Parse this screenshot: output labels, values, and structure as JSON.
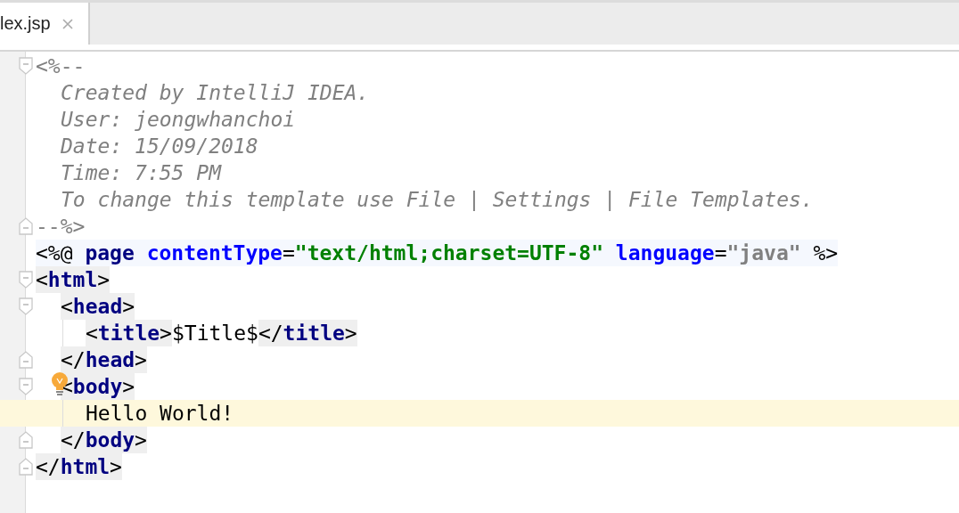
{
  "tabs": [
    {
      "label": "lex.jsp",
      "selected": true
    }
  ],
  "lines": [
    {
      "kind": "fold-start",
      "tokens": [
        {
          "kind": "comment-mark",
          "text": "<%--"
        }
      ],
      "children": [
        {
          "kind": "plain",
          "tokens": [
            {
              "kind": "comment",
              "text": "Created by IntelliJ IDEA."
            }
          ]
        },
        {
          "kind": "plain",
          "tokens": [
            {
              "kind": "comment",
              "text": "User: jeongwhanchoi"
            }
          ]
        },
        {
          "kind": "plain",
          "tokens": [
            {
              "kind": "comment",
              "text": "Date: 15/09/2018"
            }
          ]
        },
        {
          "kind": "plain",
          "tokens": [
            {
              "kind": "comment",
              "text": "Time: 7:55 PM"
            }
          ]
        },
        {
          "kind": "plain",
          "tokens": [
            {
              "kind": "comment",
              "text": "To change this template use File | Settings | File Templates."
            }
          ]
        }
      ]
    },
    {
      "kind": "fold-end",
      "tokens": [
        {
          "kind": "comment-mark",
          "text": "--%>"
        }
      ]
    },
    {
      "kind": "directive",
      "tokens": [
        {
          "kind": "punct",
          "text": "<%@ "
        },
        {
          "kind": "keyword",
          "text": "page "
        },
        {
          "kind": "attr",
          "text": "contentType"
        },
        {
          "kind": "punct",
          "text": "="
        },
        {
          "kind": "string",
          "text": "\"text/html;charset=UTF-8\" "
        },
        {
          "kind": "attr",
          "text": "language"
        },
        {
          "kind": "punct",
          "text": "="
        },
        {
          "kind": "value",
          "text": "\"java\" "
        },
        {
          "kind": "punct",
          "text": "%>"
        }
      ]
    },
    {
      "kind": "fold-start",
      "tokens": [
        {
          "kind": "tag",
          "text": "<html>"
        }
      ],
      "children": [
        {
          "kind": "fold-start",
          "tokens": [
            {
              "kind": "tag",
              "text": "<head>"
            }
          ],
          "children": [
            {
              "kind": "plain",
              "tokens": [
                {
                  "kind": "tag",
                  "text": "<title>"
                },
                {
                  "kind": "text",
                  "text": "$Title$"
                },
                {
                  "kind": "tag",
                  "text": "</title>"
                }
              ]
            }
          ]
        },
        {
          "kind": "fold-end",
          "tokens": [
            {
              "kind": "tag",
              "text": "</head>"
            }
          ]
        },
        {
          "kind": "fold-start",
          "hint": true,
          "tokens": [
            {
              "kind": "tag",
              "text": "<body>"
            }
          ],
          "children": [
            {
              "kind": "plain",
              "current": true,
              "tokens": [
                {
                  "kind": "text",
                  "text": "Hello World!"
                }
              ]
            }
          ]
        },
        {
          "kind": "fold-end",
          "tokens": [
            {
              "kind": "tag",
              "text": "</body>"
            }
          ]
        }
      ]
    },
    {
      "kind": "fold-end",
      "tokens": [
        {
          "kind": "tag",
          "text": "</html>"
        }
      ]
    }
  ]
}
